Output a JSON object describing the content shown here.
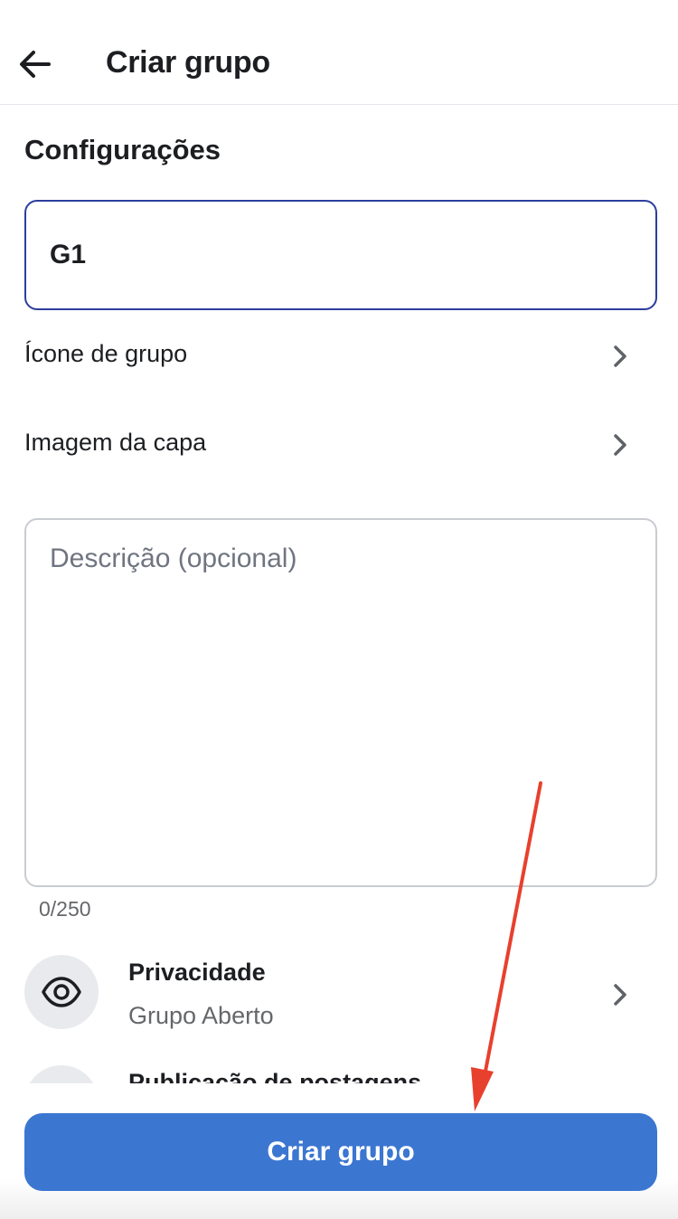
{
  "header": {
    "title": "Criar grupo",
    "back_icon": "arrow-left-icon"
  },
  "settings_section": {
    "title": "Configurações",
    "group_name_value": "G1",
    "rows": [
      {
        "label": "Ícone de grupo",
        "icon": "chevron-right-icon"
      },
      {
        "label": "Imagem da capa",
        "icon": "chevron-right-icon"
      }
    ],
    "description": {
      "placeholder": "Descrição (opcional)",
      "value": "",
      "counter": "0/250"
    }
  },
  "options": [
    {
      "title": "Privacidade",
      "subtitle": "Grupo Aberto",
      "icon": "eye-icon"
    },
    {
      "title": "Publicação de postagens",
      "subtitle": "",
      "icon": "post-icon"
    }
  ],
  "footer": {
    "create_label": "Criar grupo"
  },
  "annotation": {
    "color": "#e8402e",
    "icon": "red-arrow-annotation"
  },
  "colors": {
    "primary": "#3b76d1",
    "input_focus_border": "#2c3e9e",
    "icon_bg": "#e9eaee"
  }
}
